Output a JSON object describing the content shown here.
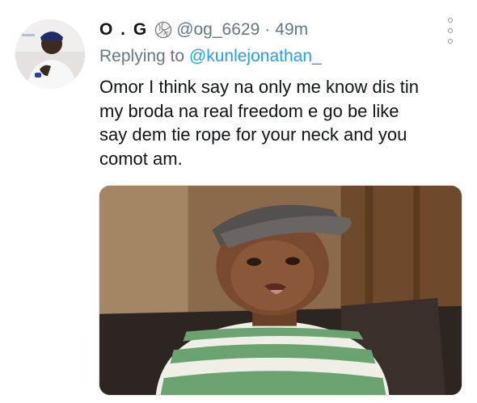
{
  "tweet": {
    "author": {
      "display_name": "O . G",
      "badge_icon": "volleyball-icon",
      "handle": "@og_6629",
      "separator": "·",
      "time": "49m"
    },
    "reply_to": {
      "prefix": "Replying to",
      "mention": "@kunlejonathan_"
    },
    "text_lines": [
      "Omor I think say na only me know dis tin",
      "my broda na real freedom e go be like",
      "say dem tie rope for your neck and you",
      "comot am."
    ],
    "menu_icon": "more-vertical-icon",
    "colors": {
      "link": "#1da1f2",
      "secondary_text": "#657786",
      "primary_text": "#0f1419"
    }
  }
}
